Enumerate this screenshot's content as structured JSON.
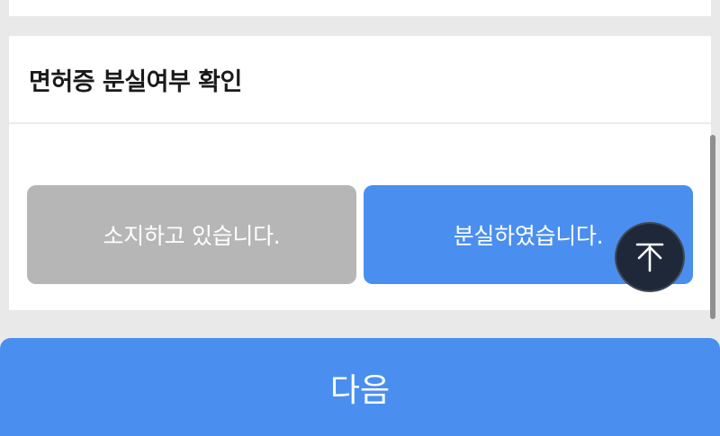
{
  "section": {
    "title": "면허증 분실여부 확인"
  },
  "choices": {
    "keep_label": "소지하고 있습니다.",
    "lost_label": "분실하였습니다.",
    "selected": "lost"
  },
  "footer": {
    "next_label": "다음"
  },
  "icons": {
    "scroll_top": "arrow-to-top-icon"
  },
  "colors": {
    "accent": "#4a8fef",
    "unselected": "#b6b6b6",
    "scroll_top_bg": "#1f2838"
  }
}
